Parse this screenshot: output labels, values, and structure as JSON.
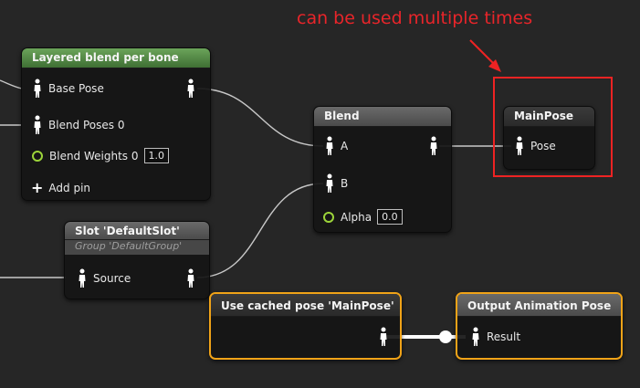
{
  "annotation": {
    "text": "can be used multiple times",
    "color": "#e8252a"
  },
  "nodes": {
    "layered_blend": {
      "title": "Layered blend per bone",
      "pins": {
        "base_pose": "Base Pose",
        "blend_poses": "Blend Poses 0",
        "blend_weights": "Blend Weights 0",
        "blend_weights_value": "1.0",
        "add_pin": "Add pin"
      }
    },
    "slot": {
      "title": "Slot 'DefaultSlot'",
      "subtitle": "Group 'DefaultGroup'",
      "pins": {
        "source": "Source"
      }
    },
    "blend": {
      "title": "Blend",
      "pins": {
        "a": "A",
        "b": "B",
        "alpha": "Alpha",
        "alpha_value": "0.0"
      }
    },
    "main_pose": {
      "title": "MainPose",
      "pins": {
        "pose": "Pose"
      }
    },
    "cached_pose": {
      "title": "Use cached pose 'MainPose'"
    },
    "output_pose": {
      "title": "Output Animation Pose",
      "pins": {
        "result": "Result"
      }
    }
  },
  "colors": {
    "background": "#262626",
    "selection": "#f0a318",
    "float_pin": "#9cd43a",
    "highlight": "#ee2323",
    "wire": "#c8c8c8"
  },
  "icons": [
    "pose-icon",
    "float-pin-icon",
    "plus-icon",
    "arrow-icon"
  ]
}
